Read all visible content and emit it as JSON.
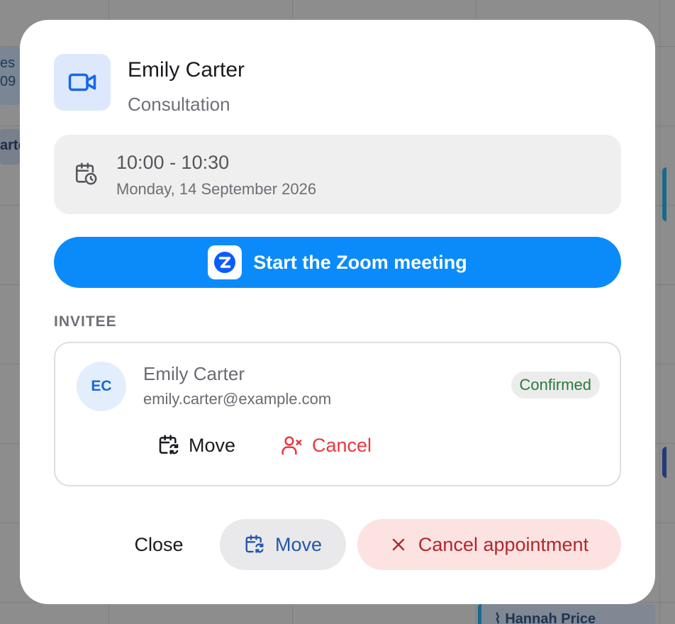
{
  "background": {
    "event_a_line1": "es",
    "event_a_line2": "09",
    "event_b_text": "arte",
    "event_c_text": "Hannah Price"
  },
  "modal": {
    "title": "Emily Carter",
    "subtitle": "Consultation",
    "header_icon": "video-camera-icon",
    "time_range": "10:00 - 10:30",
    "date": "Monday, 14 September 2026",
    "time_icon": "calendar-clock-icon",
    "zoom_button_label": "Start the Zoom meeting",
    "zoom_icon": "zoom-logo-icon",
    "section_label": "INVITEE",
    "invitee": {
      "initials": "EC",
      "name": "Emily Carter",
      "email": "emily.carter@example.com",
      "status": "Confirmed",
      "move_label": "Move",
      "cancel_label": "Cancel"
    },
    "footer": {
      "close_label": "Close",
      "move_label": "Move",
      "cancel_label": "Cancel appointment"
    }
  },
  "colors": {
    "accent": "#0b8bfa",
    "header_icon_bg": "#dde8fd",
    "status_confirmed": "#2b7a3c",
    "danger": "#e9383f",
    "danger_bg": "#fde2e2"
  }
}
